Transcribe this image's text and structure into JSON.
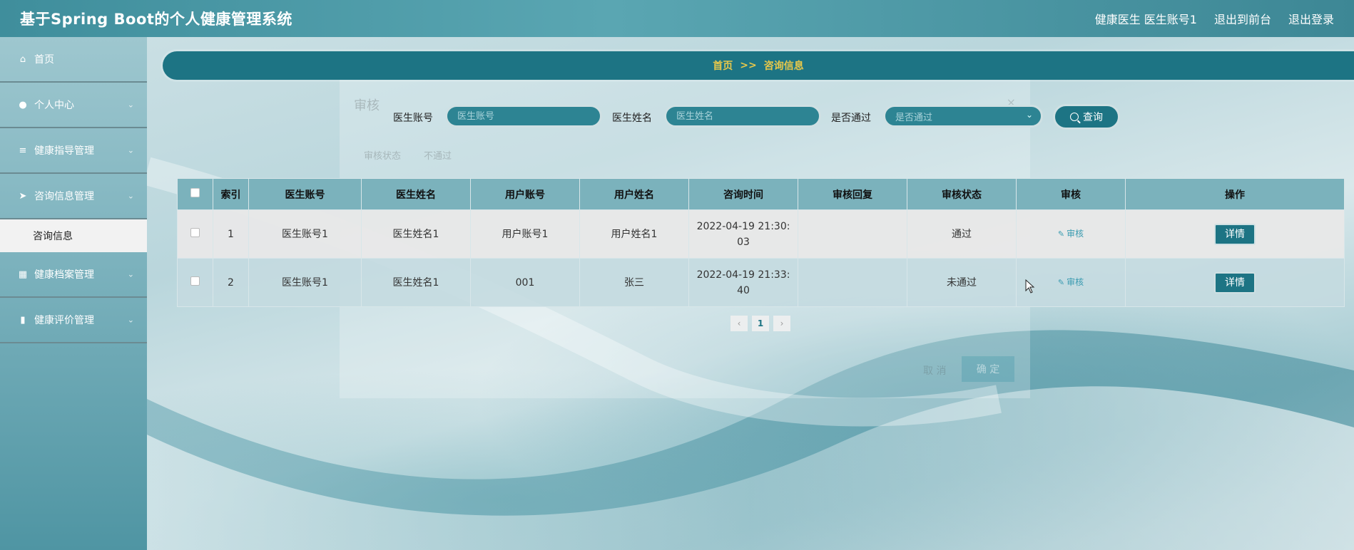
{
  "header": {
    "title": "基于Spring Boot的个人健康管理系统",
    "user_label": "健康医生 医生账号1",
    "front_label": "退出到前台",
    "logout_label": "退出登录"
  },
  "sidebar": {
    "items": [
      {
        "label": "首页",
        "icon": "home-icon"
      },
      {
        "label": "个人中心",
        "icon": "user-icon"
      },
      {
        "label": "健康指导管理",
        "icon": "list-icon"
      },
      {
        "label": "咨询信息管理",
        "icon": "send-icon"
      },
      {
        "label": "健康档案管理",
        "icon": "grid-icon"
      },
      {
        "label": "健康评价管理",
        "icon": "chart-icon"
      }
    ],
    "active_sub": "咨询信息"
  },
  "breadcrumb": {
    "home": "首页",
    "sep": ">>",
    "current": "咨询信息"
  },
  "dialog": {
    "title": "审核",
    "close": "×",
    "field_label": "审核状态",
    "field_value": "不通过",
    "cancel": "取 消",
    "ok": "确 定"
  },
  "search": {
    "doctor_account_label": "医生账号",
    "doctor_account_placeholder": "医生账号",
    "doctor_name_label": "医生姓名",
    "doctor_name_placeholder": "医生姓名",
    "passed_label": "是否通过",
    "passed_placeholder": "是否通过",
    "query_label": "查询"
  },
  "table": {
    "headers": [
      "索引",
      "医生账号",
      "医生姓名",
      "用户账号",
      "用户姓名",
      "咨询时间",
      "审核回复",
      "审核状态",
      "审核",
      "操作"
    ],
    "rows": [
      {
        "index": "1",
        "doctor_account": "医生账号1",
        "doctor_name": "医生姓名1",
        "user_account": "用户账号1",
        "user_name": "用户姓名1",
        "time": "2022-04-19 21:30:03",
        "reply": "",
        "status": "通过",
        "audit": "审核",
        "action": "详情"
      },
      {
        "index": "2",
        "doctor_account": "医生账号1",
        "doctor_name": "医生姓名1",
        "user_account": "001",
        "user_name": "张三",
        "time": "2022-04-19 21:33:40",
        "reply": "",
        "status": "未通过",
        "audit": "审核",
        "action": "详情"
      }
    ]
  },
  "pagination": {
    "prev": "‹",
    "current": "1",
    "next": "›"
  },
  "colors": {
    "accent": "#1d7484",
    "breadcrumb_text": "#e8c84a"
  }
}
